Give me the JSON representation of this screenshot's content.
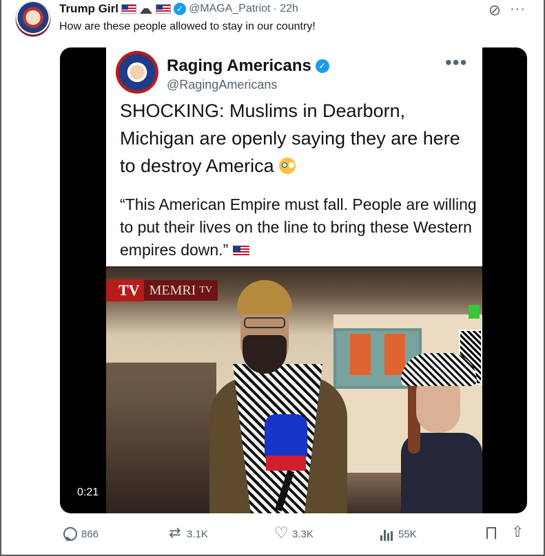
{
  "post": {
    "display_name": "Trump Girl",
    "handle": "@MAGA_Patriot",
    "time": "· 22h",
    "text": "How are these people allowed to stay in our country!"
  },
  "card": {
    "name": "Raging Americans",
    "handle": "@RagingAmericans",
    "headline": "SHOCKING: Muslims in Dearborn, Michigan are openly saying they are here to destroy America",
    "quote": "“This American Empire must fall. People are willing to put their lives on the line to bring these Western empires down.”"
  },
  "video": {
    "logo_primary": "TV",
    "logo_secondary": "MEMRI",
    "logo_tiny": "TV",
    "timestamp": "0:21"
  },
  "actions": {
    "replies": "866",
    "reposts": "3.1K",
    "likes": "3.3K",
    "views": "55K"
  },
  "icons": [
    "verified-icon",
    "flag-icon",
    "mountain-icon",
    "grok-icon",
    "more-icon",
    "reply-icon",
    "repost-icon",
    "like-icon",
    "views-icon",
    "bookmark-icon",
    "share-icon"
  ],
  "colors": {
    "verified": "#1d9bf0",
    "secondary_text": "#536471",
    "memri_red": "#b71c1c"
  }
}
